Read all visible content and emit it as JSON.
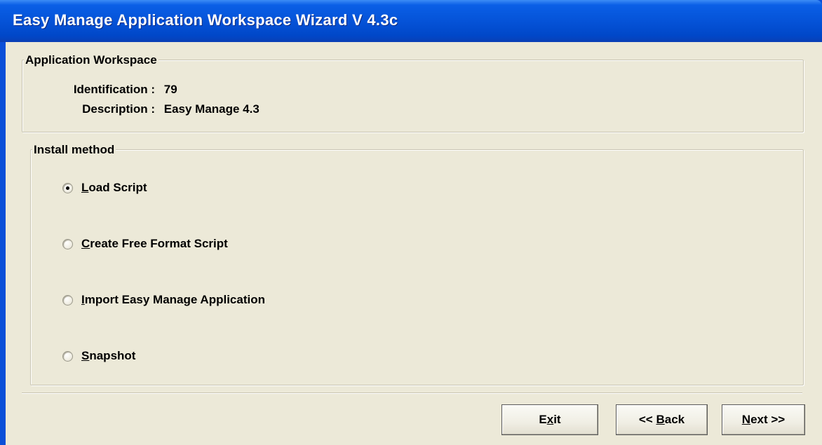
{
  "window": {
    "title": "Easy Manage Application Workspace Wizard V 4.3c"
  },
  "workspace": {
    "legend": "Application Workspace",
    "identification_label": "Identification :",
    "identification_value": "79",
    "description_label": "Description :",
    "description_value": "Easy Manage 4.3"
  },
  "install": {
    "legend": "Install method",
    "options": [
      {
        "mnemonic": "L",
        "rest": "oad Script",
        "checked": true
      },
      {
        "mnemonic": "C",
        "rest": "reate Free Format Script",
        "checked": false
      },
      {
        "mnemonic": "I",
        "rest": "mport Easy Manage Application",
        "checked": false
      },
      {
        "mnemonic": "S",
        "rest": "napshot",
        "checked": false
      }
    ]
  },
  "buttons": {
    "exit": {
      "before": "E",
      "mnemonic": "x",
      "after": "it"
    },
    "back": {
      "before": "<< ",
      "mnemonic": "B",
      "after": "ack"
    },
    "next": {
      "before": "",
      "mnemonic": "N",
      "after": "ext >>"
    }
  },
  "colors": {
    "titlebar": "#0553d8",
    "dialog_face": "#ece9d8"
  }
}
